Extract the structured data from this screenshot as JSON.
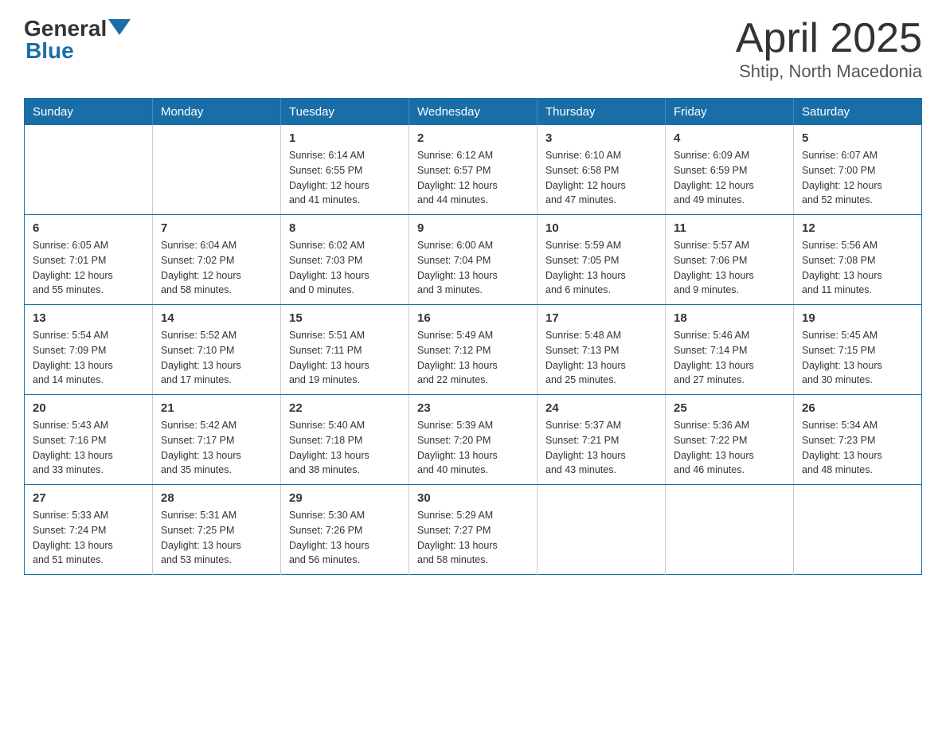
{
  "header": {
    "logo_general": "General",
    "logo_blue": "Blue",
    "title": "April 2025",
    "subtitle": "Shtip, North Macedonia"
  },
  "weekdays": [
    "Sunday",
    "Monday",
    "Tuesday",
    "Wednesday",
    "Thursday",
    "Friday",
    "Saturday"
  ],
  "weeks": [
    [
      {
        "day": "",
        "info": ""
      },
      {
        "day": "",
        "info": ""
      },
      {
        "day": "1",
        "info": "Sunrise: 6:14 AM\nSunset: 6:55 PM\nDaylight: 12 hours\nand 41 minutes."
      },
      {
        "day": "2",
        "info": "Sunrise: 6:12 AM\nSunset: 6:57 PM\nDaylight: 12 hours\nand 44 minutes."
      },
      {
        "day": "3",
        "info": "Sunrise: 6:10 AM\nSunset: 6:58 PM\nDaylight: 12 hours\nand 47 minutes."
      },
      {
        "day": "4",
        "info": "Sunrise: 6:09 AM\nSunset: 6:59 PM\nDaylight: 12 hours\nand 49 minutes."
      },
      {
        "day": "5",
        "info": "Sunrise: 6:07 AM\nSunset: 7:00 PM\nDaylight: 12 hours\nand 52 minutes."
      }
    ],
    [
      {
        "day": "6",
        "info": "Sunrise: 6:05 AM\nSunset: 7:01 PM\nDaylight: 12 hours\nand 55 minutes."
      },
      {
        "day": "7",
        "info": "Sunrise: 6:04 AM\nSunset: 7:02 PM\nDaylight: 12 hours\nand 58 minutes."
      },
      {
        "day": "8",
        "info": "Sunrise: 6:02 AM\nSunset: 7:03 PM\nDaylight: 13 hours\nand 0 minutes."
      },
      {
        "day": "9",
        "info": "Sunrise: 6:00 AM\nSunset: 7:04 PM\nDaylight: 13 hours\nand 3 minutes."
      },
      {
        "day": "10",
        "info": "Sunrise: 5:59 AM\nSunset: 7:05 PM\nDaylight: 13 hours\nand 6 minutes."
      },
      {
        "day": "11",
        "info": "Sunrise: 5:57 AM\nSunset: 7:06 PM\nDaylight: 13 hours\nand 9 minutes."
      },
      {
        "day": "12",
        "info": "Sunrise: 5:56 AM\nSunset: 7:08 PM\nDaylight: 13 hours\nand 11 minutes."
      }
    ],
    [
      {
        "day": "13",
        "info": "Sunrise: 5:54 AM\nSunset: 7:09 PM\nDaylight: 13 hours\nand 14 minutes."
      },
      {
        "day": "14",
        "info": "Sunrise: 5:52 AM\nSunset: 7:10 PM\nDaylight: 13 hours\nand 17 minutes."
      },
      {
        "day": "15",
        "info": "Sunrise: 5:51 AM\nSunset: 7:11 PM\nDaylight: 13 hours\nand 19 minutes."
      },
      {
        "day": "16",
        "info": "Sunrise: 5:49 AM\nSunset: 7:12 PM\nDaylight: 13 hours\nand 22 minutes."
      },
      {
        "day": "17",
        "info": "Sunrise: 5:48 AM\nSunset: 7:13 PM\nDaylight: 13 hours\nand 25 minutes."
      },
      {
        "day": "18",
        "info": "Sunrise: 5:46 AM\nSunset: 7:14 PM\nDaylight: 13 hours\nand 27 minutes."
      },
      {
        "day": "19",
        "info": "Sunrise: 5:45 AM\nSunset: 7:15 PM\nDaylight: 13 hours\nand 30 minutes."
      }
    ],
    [
      {
        "day": "20",
        "info": "Sunrise: 5:43 AM\nSunset: 7:16 PM\nDaylight: 13 hours\nand 33 minutes."
      },
      {
        "day": "21",
        "info": "Sunrise: 5:42 AM\nSunset: 7:17 PM\nDaylight: 13 hours\nand 35 minutes."
      },
      {
        "day": "22",
        "info": "Sunrise: 5:40 AM\nSunset: 7:18 PM\nDaylight: 13 hours\nand 38 minutes."
      },
      {
        "day": "23",
        "info": "Sunrise: 5:39 AM\nSunset: 7:20 PM\nDaylight: 13 hours\nand 40 minutes."
      },
      {
        "day": "24",
        "info": "Sunrise: 5:37 AM\nSunset: 7:21 PM\nDaylight: 13 hours\nand 43 minutes."
      },
      {
        "day": "25",
        "info": "Sunrise: 5:36 AM\nSunset: 7:22 PM\nDaylight: 13 hours\nand 46 minutes."
      },
      {
        "day": "26",
        "info": "Sunrise: 5:34 AM\nSunset: 7:23 PM\nDaylight: 13 hours\nand 48 minutes."
      }
    ],
    [
      {
        "day": "27",
        "info": "Sunrise: 5:33 AM\nSunset: 7:24 PM\nDaylight: 13 hours\nand 51 minutes."
      },
      {
        "day": "28",
        "info": "Sunrise: 5:31 AM\nSunset: 7:25 PM\nDaylight: 13 hours\nand 53 minutes."
      },
      {
        "day": "29",
        "info": "Sunrise: 5:30 AM\nSunset: 7:26 PM\nDaylight: 13 hours\nand 56 minutes."
      },
      {
        "day": "30",
        "info": "Sunrise: 5:29 AM\nSunset: 7:27 PM\nDaylight: 13 hours\nand 58 minutes."
      },
      {
        "day": "",
        "info": ""
      },
      {
        "day": "",
        "info": ""
      },
      {
        "day": "",
        "info": ""
      }
    ]
  ]
}
